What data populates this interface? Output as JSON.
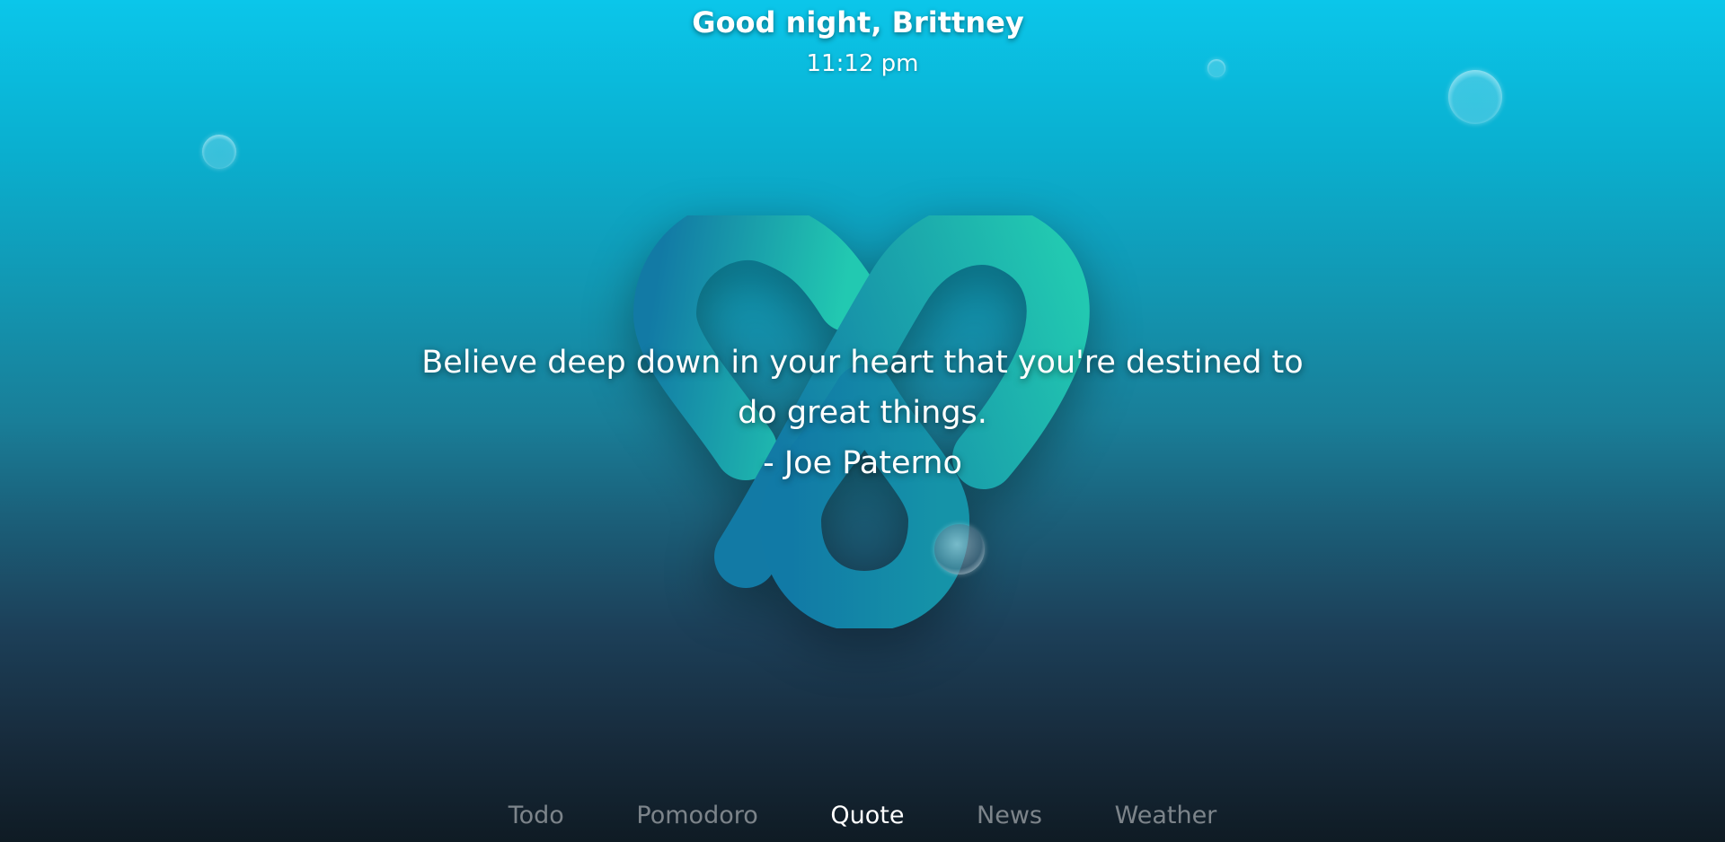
{
  "header": {
    "greeting": "Good night, Brittney",
    "time": "11:12 pm"
  },
  "quote": {
    "text": "Believe deep down in your heart that you're destined to do great things.",
    "author": "- Joe Paterno"
  },
  "nav": {
    "items": [
      {
        "label": "Todo",
        "active": false
      },
      {
        "label": "Pomodoro",
        "active": false
      },
      {
        "label": "Quote",
        "active": true
      },
      {
        "label": "News",
        "active": false
      },
      {
        "label": "Weather",
        "active": false
      }
    ]
  },
  "colors": {
    "logo_teal": "#22c9b1",
    "logo_blue": "#127aa5",
    "nav_active": "#ffffff",
    "nav_inactive": "#9cb4c0"
  }
}
